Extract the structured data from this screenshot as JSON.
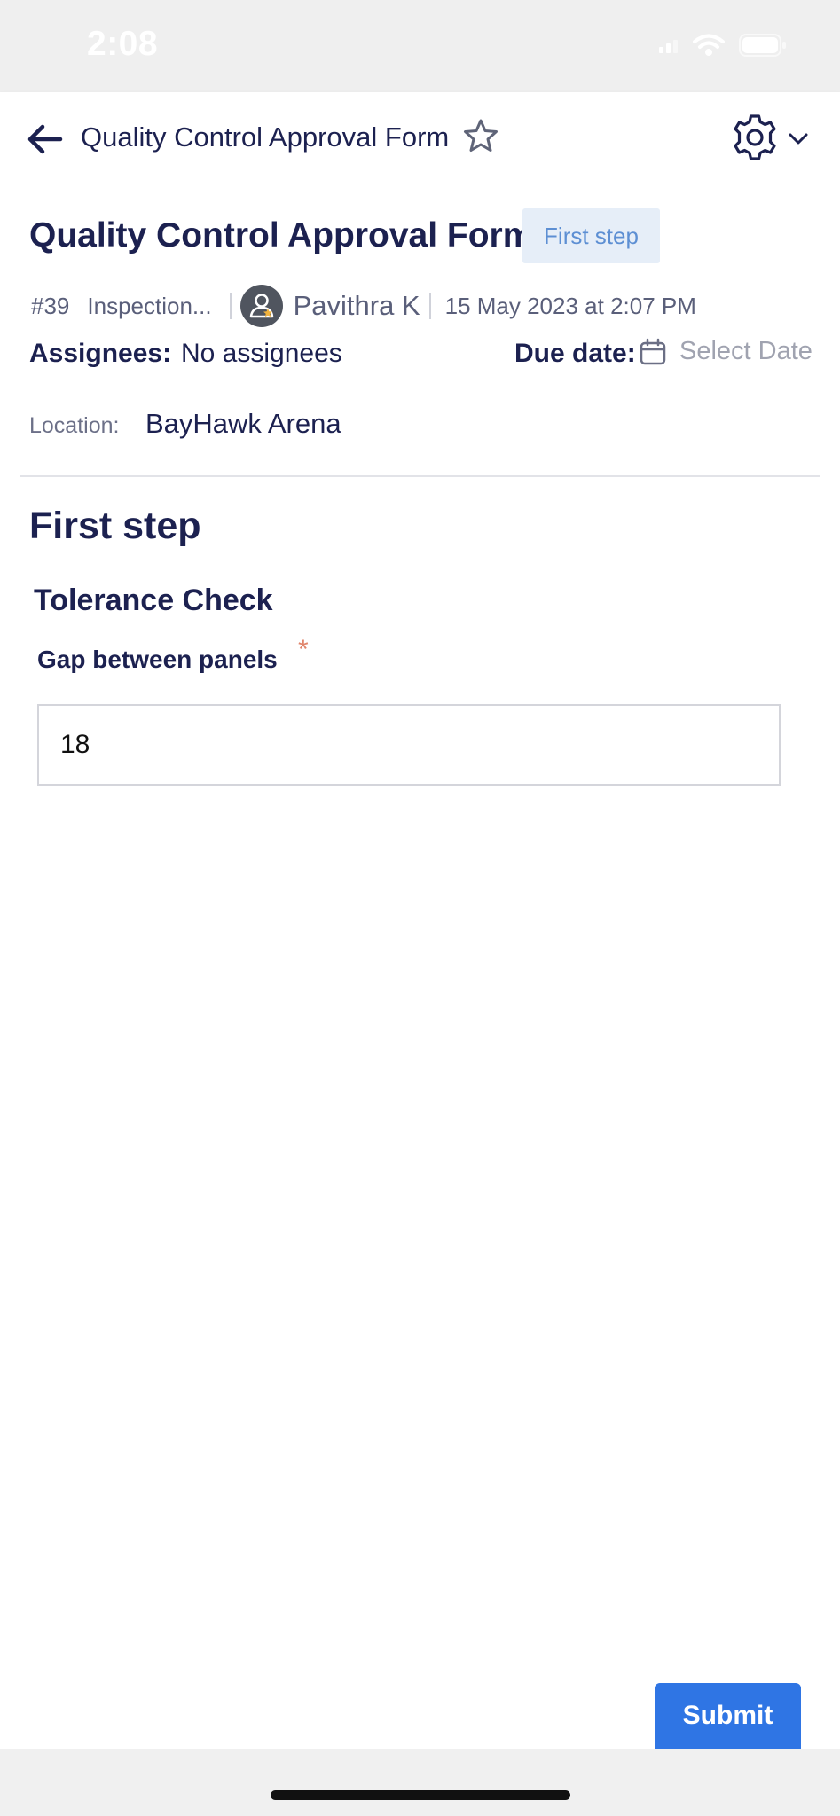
{
  "status_bar": {
    "time": "2:08"
  },
  "header": {
    "title": "Quality Control Approval Form"
  },
  "form": {
    "title": "Quality Control Approval Form",
    "step_badge": "First step",
    "meta": {
      "id": "#39",
      "category": "Inspection...",
      "user": "Pavithra K",
      "date": "15 May 2023 at 2:07 PM"
    },
    "assignees_label": "Assignees:",
    "assignees_value": "No assignees",
    "due_label": "Due date:",
    "due_placeholder": "Select Date",
    "location_label": "Location:",
    "location_value": "BayHawk Arena"
  },
  "step": {
    "heading": "First step",
    "section": "Tolerance Check",
    "field_label": "Gap between panels",
    "required_mark": "*",
    "field_value": "18"
  },
  "actions": {
    "submit_label": "Submit"
  },
  "colors": {
    "accent": "#2f75e4",
    "text": "#1c2150",
    "badge_bg": "#e6eef8",
    "required": "#e0856b"
  }
}
